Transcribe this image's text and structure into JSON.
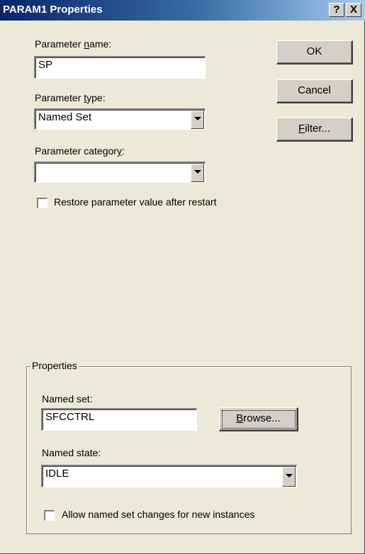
{
  "window": {
    "title": "PARAM1 Properties",
    "help_glyph": "?",
    "close_glyph": "X"
  },
  "param_name": {
    "label_pre": "Parameter ",
    "label_u": "n",
    "label_post": "ame:",
    "value": "SP"
  },
  "param_type": {
    "label_pre": "Parameter ",
    "label_u": "t",
    "label_post": "ype:",
    "value": "Named Set"
  },
  "param_category": {
    "label_pre": "Parameter categor",
    "label_u": "y",
    "label_post": ":",
    "value": ""
  },
  "restore_checkbox": {
    "label": "Restore parameter value after restart",
    "checked": false
  },
  "buttons": {
    "ok": "OK",
    "cancel": "Cancel",
    "filter_u": "F",
    "filter_rest": "ilter..."
  },
  "properties_group": {
    "title": "Properties",
    "named_set_label": "Named set:",
    "named_set_value": "SFCCTRL",
    "browse_u": "B",
    "browse_rest": "rowse...",
    "named_state_label": "Named state:",
    "named_state_value": "IDLE",
    "allow_changes_label": "Allow named set changes for new instances",
    "allow_changes_checked": false
  },
  "icons": [
    "help-icon",
    "close-icon",
    "dropdown-arrow-icon",
    "checkbox-icon"
  ]
}
